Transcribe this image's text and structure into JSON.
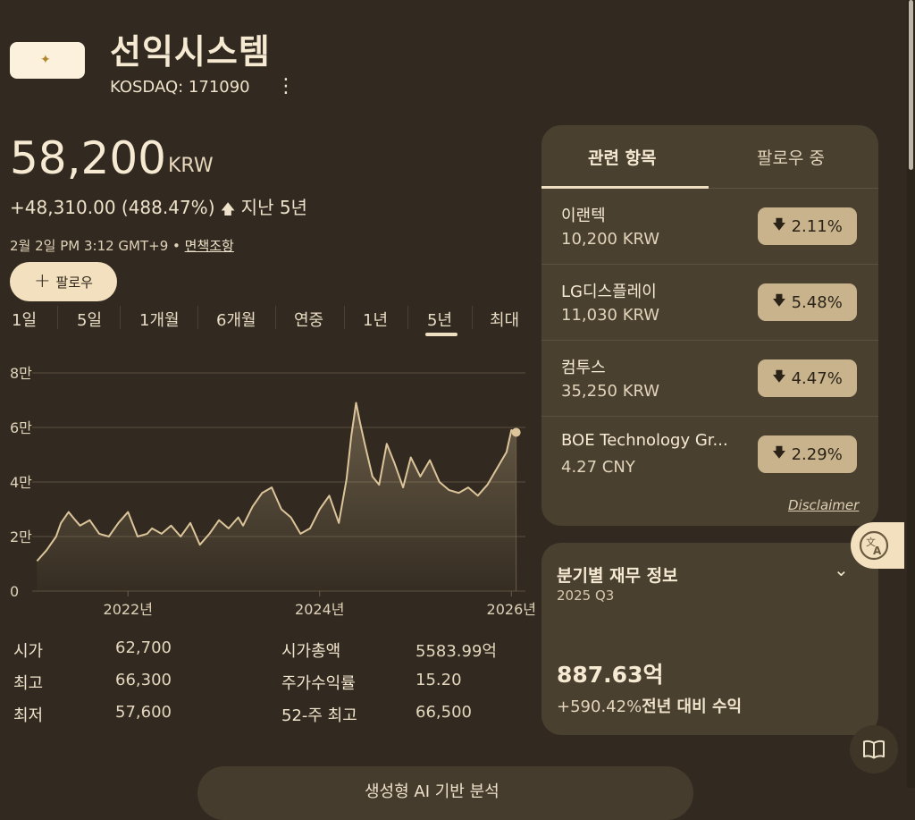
{
  "header": {
    "company_name": "선익시스템",
    "ticker": "KOSDAQ: 171090",
    "more_icon": "⋮"
  },
  "quote": {
    "price": "58,200",
    "currency": "KRW",
    "change": "+48,310.00 (488.47%)",
    "change_arrow": "🡅",
    "period": "지난 5년",
    "timestamp": "2월 2일 PM 3:12 GMT+9 • ",
    "disclaimer_link": "면책조항",
    "follow_label": "팔로우",
    "follow_icon": "+"
  },
  "ranges": [
    {
      "label": "1일",
      "selected": false
    },
    {
      "label": "5일",
      "selected": false
    },
    {
      "label": "1개월",
      "selected": false
    },
    {
      "label": "6개월",
      "selected": false
    },
    {
      "label": "연중",
      "selected": false
    },
    {
      "label": "1년",
      "selected": false
    },
    {
      "label": "5년",
      "selected": true
    },
    {
      "label": "최대",
      "selected": false
    }
  ],
  "chart_data": {
    "type": "area",
    "x_ticks": [
      "2022년",
      "2024년",
      "2026년"
    ],
    "y_ticks": [
      "0",
      "2만",
      "4만",
      "6만",
      "8만"
    ],
    "ylim": [
      0,
      80000
    ],
    "xlim": [
      2021.0,
      2026.1
    ],
    "grid": true,
    "line_color": "#dcc59a",
    "x": [
      2021.05,
      2021.15,
      2021.25,
      2021.3,
      2021.38,
      2021.45,
      2021.5,
      2021.6,
      2021.7,
      2021.8,
      2021.9,
      2022.0,
      2022.1,
      2022.2,
      2022.25,
      2022.35,
      2022.45,
      2022.55,
      2022.65,
      2022.75,
      2022.85,
      2022.95,
      2023.05,
      2023.15,
      2023.2,
      2023.3,
      2023.4,
      2023.5,
      2023.6,
      2023.7,
      2023.8,
      2023.9,
      2024.0,
      2024.1,
      2024.2,
      2024.28,
      2024.33,
      2024.38,
      2024.42,
      2024.47,
      2024.55,
      2024.62,
      2024.7,
      2024.78,
      2024.87,
      2024.95,
      2025.05,
      2025.15,
      2025.25,
      2025.35,
      2025.45,
      2025.55,
      2025.65,
      2025.75,
      2025.85,
      2025.95,
      2026.0,
      2026.05
    ],
    "values": [
      11000,
      15000,
      20000,
      25000,
      29000,
      26000,
      24000,
      26000,
      21000,
      20000,
      25000,
      29000,
      20000,
      21000,
      23000,
      21000,
      24000,
      20000,
      25000,
      17000,
      21000,
      26000,
      23000,
      27000,
      24000,
      31000,
      36000,
      38000,
      30000,
      27000,
      21000,
      23000,
      30000,
      35000,
      25000,
      41000,
      57000,
      69000,
      62000,
      54000,
      42000,
      39000,
      54000,
      47000,
      38000,
      49000,
      42000,
      48000,
      40000,
      37000,
      36000,
      38000,
      35000,
      39000,
      45000,
      51000,
      59000,
      58200
    ],
    "series": [
      {
        "values_ref": "values"
      }
    ]
  },
  "stats": {
    "left": [
      {
        "label": "시가",
        "value": "62,700"
      },
      {
        "label": "최고",
        "value": "66,300"
      },
      {
        "label": "최저",
        "value": "57,600"
      }
    ],
    "right": [
      {
        "label": "시가총액",
        "value": "5583.99억"
      },
      {
        "label": "주가수익률",
        "value": "15.20"
      },
      {
        "label": "52-주 최고",
        "value": "66,500"
      }
    ]
  },
  "related": {
    "tab_related": "관련 항목",
    "tab_following": "팔로우 중",
    "items": [
      {
        "name": "이랜텍",
        "price": "10,200 KRW",
        "change": "2.11%",
        "arrow": "🡇"
      },
      {
        "name": "LG디스플레이",
        "price": "11,030 KRW",
        "change": "5.48%",
        "arrow": "🡇"
      },
      {
        "name": "컴투스",
        "price": "35,250 KRW",
        "change": "4.47%",
        "arrow": "🡇"
      },
      {
        "name": "BOE Technology Gr...",
        "price": "4.27 CNY",
        "change": "2.29%",
        "arrow": "🡇"
      }
    ],
    "disclaimer": "Disclaimer"
  },
  "financials": {
    "title": "분기별 재무 정보",
    "period": "2025 Q3",
    "value": "887.63억",
    "change_pct": "+590.42%",
    "change_label": "전년 대비 수익",
    "chevron_icon": "⌄"
  },
  "bottom": {
    "label": "생성형 AI 기반 분석"
  },
  "colors": {
    "background": "#322a20",
    "card": "#4a4030",
    "accent": "#f3e0bf",
    "pill": "#c8b38d"
  }
}
